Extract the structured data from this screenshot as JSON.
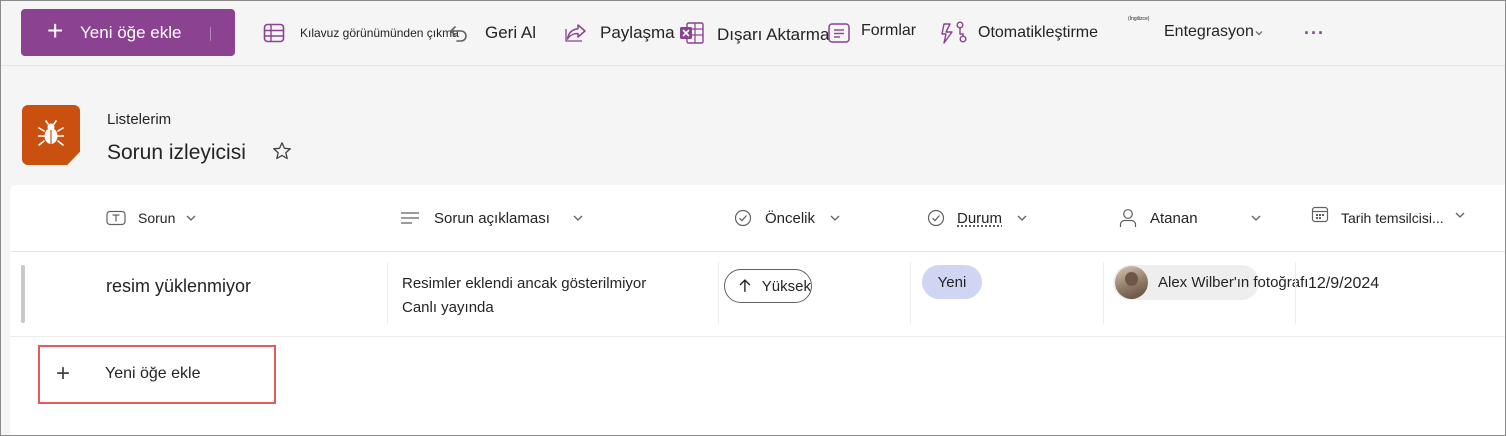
{
  "toolbar": {
    "new_item_label": "Yeni öğe ekle",
    "grid_view_exit_label": "Kılavuz görünümünden çıkma",
    "undo_label": "Geri Al",
    "share_label": "Paylaşma",
    "export_label": "Dışarı Aktarma",
    "forms_label": "Formlar",
    "automate_label": "Otomatikleştirme",
    "integrate_label": "Entegrasyon",
    "integrate_tiny_label": "(İngilizce)",
    "more_label": "···"
  },
  "header": {
    "breadcrumb": "Listelerim",
    "title": "Sorun izleyicisi",
    "icon": "bug-icon",
    "accent_color": "#ca5010"
  },
  "columns": [
    {
      "label": "Sorun",
      "icon": "text-field-icon"
    },
    {
      "label": "Sorun açıklaması",
      "icon": "multiline-text-icon"
    },
    {
      "label": "Öncelik",
      "icon": "choice-check-icon"
    },
    {
      "label": "Durum",
      "icon": "choice-check-icon"
    },
    {
      "label": "Atanan",
      "icon": "person-icon"
    },
    {
      "label": "Tarih temsilcisi...",
      "icon": "calendar-icon"
    }
  ],
  "rows": [
    {
      "issue": "resim yüklenmiyor",
      "description_line1": "Resimler eklendi ancak gösterilmiyor",
      "description_line2": "Canlı yayında",
      "priority": "Yüksek",
      "status": "Yeni",
      "assignee": "Alex Wilber'ın fotoğrafı",
      "date": "12/9/2024"
    }
  ],
  "add_row": {
    "label": "Yeni öğe ekle"
  },
  "colors": {
    "primary_button": "#8a4291",
    "status_pill": "#cfd5f2",
    "highlight_border": "#e15c5c"
  }
}
